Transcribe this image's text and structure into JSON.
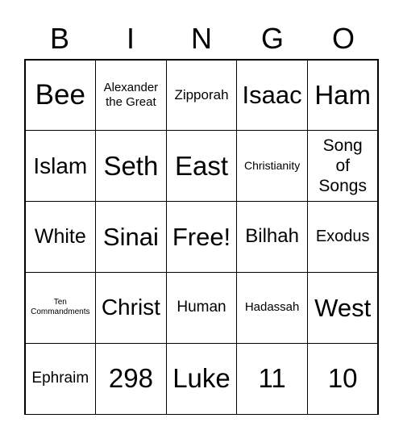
{
  "header": [
    "B",
    "I",
    "N",
    "G",
    "O"
  ],
  "cells": [
    "Bee",
    "Alexander the Great",
    "Zipporah",
    "Isaac",
    "Ham",
    "Islam",
    "Seth",
    "East",
    "Christianity",
    "Song of Songs",
    "White",
    "Sinai",
    "Free!",
    "Bilhah",
    "Exodus",
    "Ten Commandments",
    "Christ",
    "Human",
    "Hadassah",
    "West",
    "Ephraim",
    "298",
    "Luke",
    "11",
    "10"
  ]
}
